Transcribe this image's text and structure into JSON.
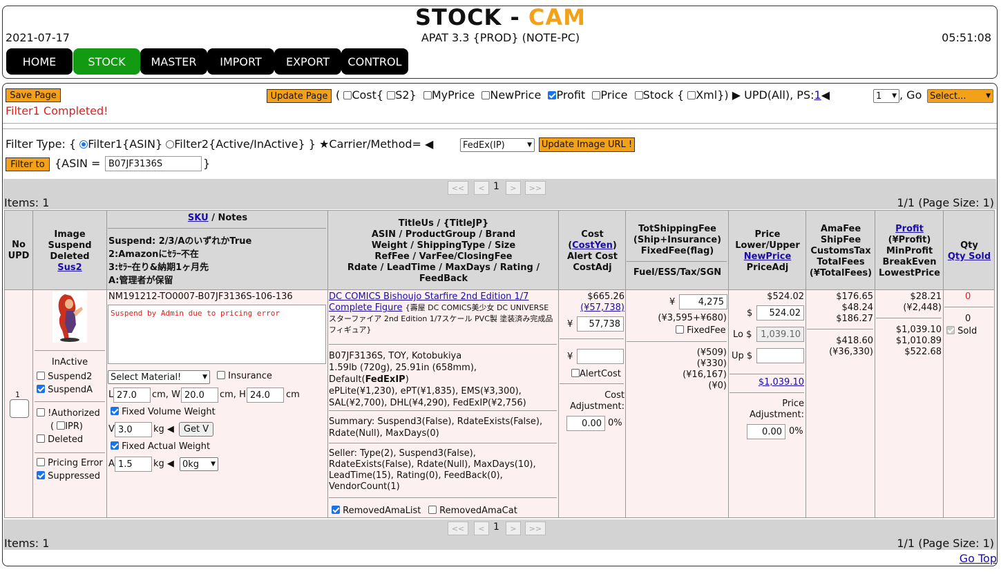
{
  "header": {
    "title_main": "STOCK - ",
    "title_accent": "CAM",
    "date": "2021-07-17",
    "app_info": "APAT 3.3 {PROD} (NOTE-PC)",
    "time": "05:51:08",
    "accent_color": "#f4a11a"
  },
  "nav": {
    "items": [
      "HOME",
      "STOCK",
      "MASTER",
      "IMPORT",
      "EXPORT",
      "CONTROL"
    ],
    "active": "STOCK",
    "active_color": "#129b12"
  },
  "toolbar": {
    "save_label": "Save Page",
    "status": "Filter1 Completed!",
    "update_label": "Update Page",
    "open_paren": "(",
    "cost": "Cost{",
    "s2": "S2}",
    "myprice": "MyPrice",
    "newprice": "NewPrice",
    "profit": "Profit",
    "price": "Price",
    "stock": "Stock {",
    "xml": "Xml})",
    "upd_all": "▶ UPD(All), PS:",
    "ps_link": "1",
    "ps_arrow": "◀",
    "ps_select": "1",
    "go": ", Go",
    "go_select": "Select..."
  },
  "filter": {
    "label": "Filter Type: {",
    "opt1": "Filter1{ASIN}",
    "opt2": "Filter2{Active/InActive}",
    "close": "}",
    "carrier_label": "★Carrier/Method=",
    "carrier_arrow": "◀",
    "carrier_value": "FedEx(IP)",
    "update_image_label": "Update Image URL !",
    "filter_to_label": "Filter to",
    "asin_label": "{ASIN =",
    "asin_value": "B07JF3136S",
    "asin_close": "}"
  },
  "pager": {
    "first": "<<",
    "prev": "<",
    "page": "1",
    "next": ">",
    "last": ">>",
    "items_label": "Items: 1",
    "page_info": "1/1 (Page Size: 1)"
  },
  "table": {
    "headers": {
      "no": "No",
      "upd": "UPD",
      "image": "Image",
      "suspend": "Suspend",
      "deleted": "Deleted",
      "sus2": "Sus2",
      "sku": "SKU",
      "notes": " / Notes",
      "suspend_rule": "Suspend: 2/3/AのいずれかTrue",
      "rule2": "2:Amazonにｾﾗｰ不在",
      "rule3": "3:ｾﾗｰ在り&納期1ヶ月先",
      "ruleA": "A:管理者が保留",
      "title1": "TitleUs / {TitleJP}",
      "title2": "ASIN / ProductGroup / Brand",
      "title3": "Weight / ShippingType / Size",
      "title4": "RefFee / VarFee/ClosingFee",
      "title5": "Rdate / LeadTime / MaxDays / Rating /",
      "title6": "FeedBack",
      "cost": "Cost",
      "costyen": "CostYen",
      "alert_cost": "Alert Cost",
      "costadj": "CostAdj",
      "ship1": "TotShippingFee",
      "ship2": "(Ship+Insurance)",
      "ship3": "FixedFee(flag)",
      "fuel": "Fuel/ESS/Tax/SGN",
      "price": "Price",
      "lowup": "Lower/Upper",
      "newprice": "NewPrice",
      "priceadj": "PriceAdj",
      "amafee": "AmaFee",
      "shipfee": "ShipFee",
      "customs": "CustomsTax",
      "totalfees": "TotalFees",
      "totalfees_yen": "(¥TotalFees)",
      "profit": "Profit",
      "profit_yen": "(¥Profit)",
      "minprofit": "MinProfit",
      "breakeven": "BreakEven",
      "lowest": "LowestPrice",
      "qty": "Qty",
      "qty_sold": "Qty Sold"
    },
    "row": {
      "no": "1",
      "status": "InActive",
      "suspend2": "Suspend2",
      "suspendA": "SuspendA",
      "authorized": "!Authorized",
      "ipr_open": "(",
      "ipr": "IPR)",
      "deleted": "Deleted",
      "pricing_error": "Pricing Error",
      "suppressed": "Suppressed",
      "sku": "NM191212-TO0007-B07JF3136S-106-136",
      "note": "Suspend by Admin due to pricing error",
      "material": "Select Material!",
      "insurance": "Insurance",
      "l_label": "L",
      "l_val": "27.0",
      "w_label": "cm, W",
      "w_val": "20.0",
      "h_label": "cm, H",
      "h_val": "24.0",
      "cm": "cm",
      "fixed_vol": "Fixed Volume Weight",
      "v_label": "V",
      "v_val": "3.0",
      "kg": "kg ◀",
      "getv": "Get V",
      "fixed_act": "Fixed Actual Weight",
      "a_label": "A",
      "a_val": "1.5",
      "kg_sel": "0kg",
      "title_link": "DC COMICS Bishoujo Starfire 2nd Edition 1/7 Complete Figure",
      "title_jp": "{壽屋 DC COMICS美少女 DC UNIVERSE スターファイア 2nd Edition 1/7スケール PVC製 塗装済み完成品フィギュア}",
      "info1": "B07JF3136S, TOY, Kotobukiya",
      "info2": "1.59lb (720g), 25.91in (658mm),",
      "info3a": "Default(",
      "info3b": "FedExIP",
      "info3c": ")",
      "info4": "ePLite(¥1,230), ePT(¥1,835), EMS(¥3,300),",
      "info5": "SAL(¥2,700), DHL(¥4,290), FedExIP(¥2,756)",
      "summary": "Summary: Suspend3(False), RdateExists(False), Rdate(Null), MaxDays(0)",
      "seller": "Seller: Type(2), Suspend3(False), RdateExists(False), Rdate(Null), MaxDays(10), LeadTime(15), Rating(0), FeedBack(0), VendorCount(1)",
      "removed_list": "RemovedAmaList",
      "removed_cat": "RemovedAmaCat",
      "cost_usd": "$665.26",
      "cost_yen_link": "(¥57,738)",
      "yen": "¥",
      "cost_input": "57,738",
      "alert_yen": "¥",
      "alert_label": "AlertCost",
      "cost_adj_label": "Cost Adjustment:",
      "cost_adj_val": "0.00",
      "pct": "0%",
      "ship_yen": "¥",
      "ship_val": "4,275",
      "ship_breakdown": "(¥3,595+¥680)",
      "fixed_fee": "FixedFee",
      "fuel": "(¥509)",
      "ess": "(¥330)",
      "tax": "(¥16,167)",
      "sgn": "(¥0)",
      "price_top": "$524.02",
      "price_dollar": "$",
      "price_input": "524.02",
      "lo_label": "Lo $",
      "lo_val": "1,039.10",
      "up_label": "Up $",
      "newprice_link": "$1,039.10",
      "price_adj_label": "Price Adjustment:",
      "price_adj_val": "0.00",
      "price_pct": "0%",
      "amafee": "$176.65",
      "shipfee": "$48.24",
      "customs": "$186.27",
      "totalfees": "$418.60",
      "totalfees_yen": "(¥36,330)",
      "profit": "$28.21",
      "profit_yen": "(¥2,448)",
      "minprofit": "$1,039.10",
      "breakeven": "$1,010.89",
      "lowest": "$522.68",
      "qty": "0",
      "qty_sold": "0",
      "sold": "Sold"
    }
  },
  "footer": {
    "go_top": "Go Top"
  }
}
